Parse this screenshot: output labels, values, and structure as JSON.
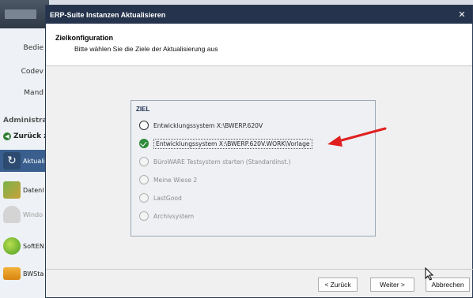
{
  "background": {
    "nav": [
      "Bedie",
      "Codev",
      "Mand"
    ],
    "section_label": "Administrat",
    "back_label": "Zurück z",
    "items": [
      {
        "label": "Aktuali",
        "icon": "refresh-icon",
        "active": true
      },
      {
        "label": "Datenl",
        "icon": "database-icon",
        "active": false
      },
      {
        "label": "Windo",
        "icon": "user-icon",
        "active": false
      },
      {
        "label": "SoftEN",
        "icon": "apple-icon",
        "active": false
      },
      {
        "label": "BWSta",
        "icon": "folder-icon",
        "active": false
      }
    ]
  },
  "dialog": {
    "title": "ERP-Suite Instanzen Aktualisieren",
    "close_icon": "close-icon",
    "header_title": "Zielkonfiguration",
    "header_subtitle": "Bitte wählen Sie die Ziele der Aktualisierung aus",
    "group_title": "ZIEL",
    "options": [
      {
        "label": "Entwicklungssystem X:\\BWERP.620V",
        "state": "unchecked"
      },
      {
        "label": "Entwicklungssystem X:\\BWERP.620V.WORK\\Vorlage",
        "state": "checked"
      },
      {
        "label": "BüroWARE Testsystem starten (Standardinst.)",
        "state": "disabled"
      },
      {
        "label": "Meine Wiese 2",
        "state": "disabled"
      },
      {
        "label": "LastGood",
        "state": "disabled"
      },
      {
        "label": "Archivsystem",
        "state": "disabled"
      }
    ],
    "buttons": {
      "back": "< Zurück",
      "next": "Weiter >",
      "cancel": "Abbrechen"
    },
    "annotation_color": "#e02020"
  }
}
